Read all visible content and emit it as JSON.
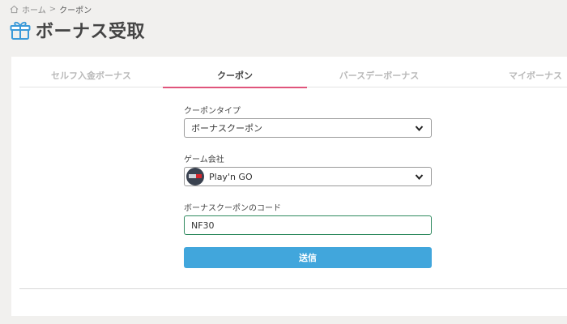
{
  "breadcrumb": {
    "home_label": "ホーム",
    "separator": ">",
    "current_label": "クーポン"
  },
  "page": {
    "title": "ボーナス受取"
  },
  "tabs": [
    {
      "label": "セルフ入金ボーナス",
      "active": false
    },
    {
      "label": "クーポン",
      "active": true
    },
    {
      "label": "バースデーボーナス",
      "active": false
    },
    {
      "label": "マイボーナス",
      "active": false
    }
  ],
  "form": {
    "coupon_type": {
      "label": "クーポンタイプ",
      "selected": "ボーナスクーポン"
    },
    "game_company": {
      "label": "ゲーム会社",
      "selected": "Play'n GO"
    },
    "coupon_code": {
      "label": "ボーナスクーポンのコード",
      "value": "NF30"
    },
    "submit_label": "送信"
  },
  "colors": {
    "active_tab_underline": "#e0557c",
    "submit_button": "#41a6dc",
    "input_focus_border": "#2f8a5f",
    "title_icon": "#3b9ad9"
  },
  "icons": {
    "breadcrumb_home": "home-icon",
    "title": "gift-icon",
    "select_chevron": "chevron-down-icon"
  }
}
